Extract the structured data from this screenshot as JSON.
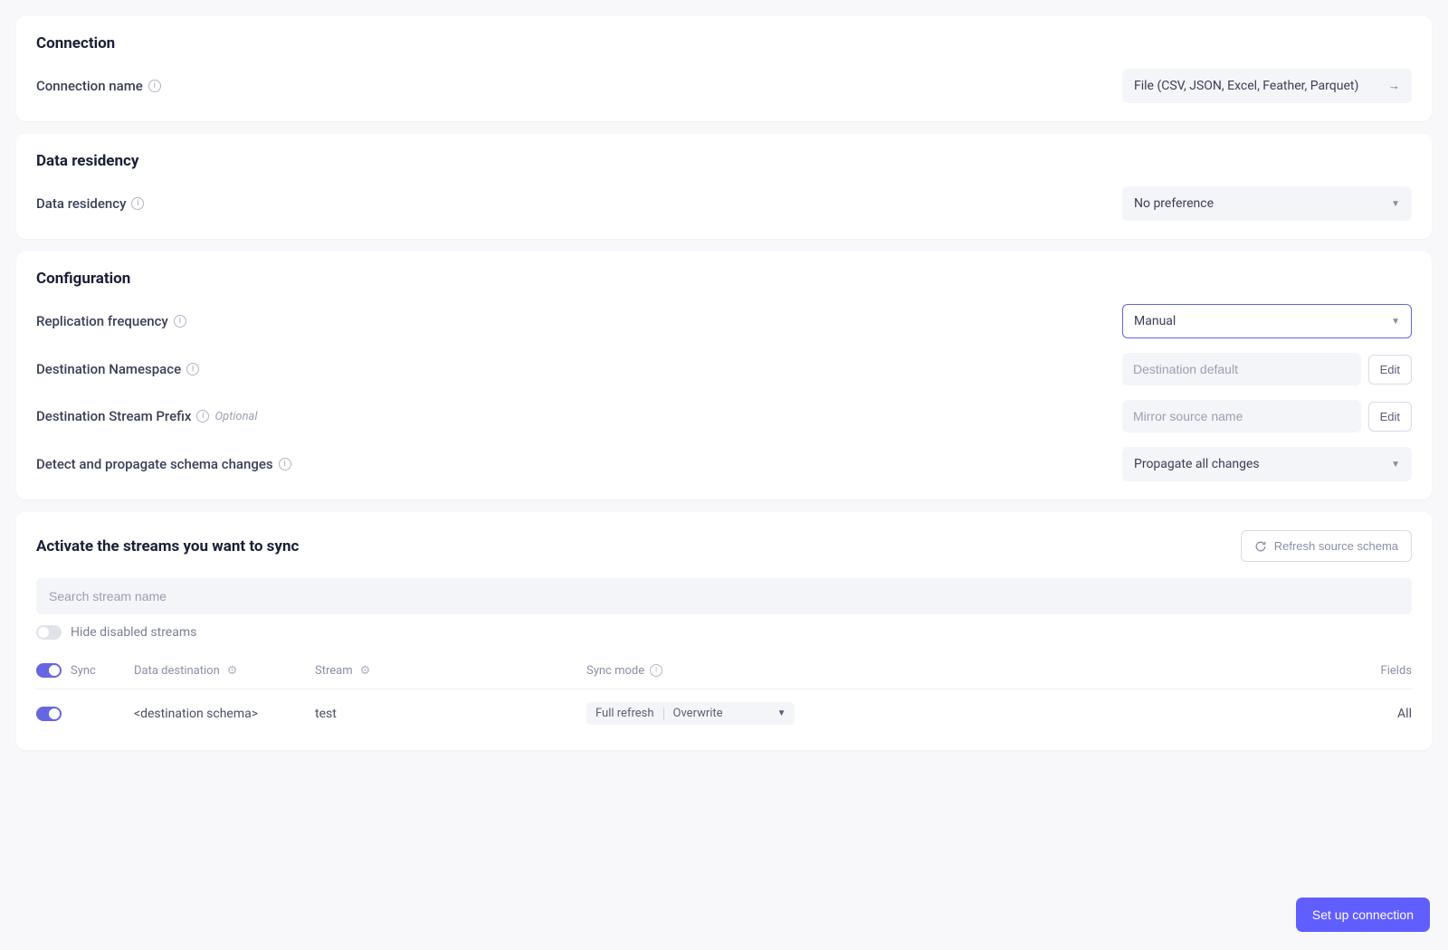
{
  "connection": {
    "title": "Connection",
    "name_label": "Connection name",
    "name_value": "File (CSV, JSON, Excel, Feather, Parquet)"
  },
  "residency": {
    "title": "Data residency",
    "label": "Data residency",
    "value": "No preference"
  },
  "configuration": {
    "title": "Configuration",
    "replication_label": "Replication frequency",
    "replication_value": "Manual",
    "namespace_label": "Destination Namespace",
    "namespace_placeholder": "Destination default",
    "prefix_label": "Destination Stream Prefix",
    "prefix_optional": "Optional",
    "prefix_placeholder": "Mirror source name",
    "schema_label": "Detect and propagate schema changes",
    "schema_value": "Propagate all changes",
    "edit_label": "Edit"
  },
  "streams": {
    "title": "Activate the streams you want to sync",
    "refresh_label": "Refresh source schema",
    "search_placeholder": "Search stream name",
    "hide_disabled_label": "Hide disabled streams",
    "headers": {
      "sync": "Sync",
      "data_destination": "Data destination",
      "stream": "Stream",
      "sync_mode": "Sync mode",
      "fields": "Fields"
    },
    "row": {
      "destination": "<destination schema>",
      "stream": "test",
      "sync_mode_left": "Full refresh",
      "sync_mode_right": "Overwrite",
      "fields": "All"
    }
  },
  "footer": {
    "setup_label": "Set up connection"
  }
}
